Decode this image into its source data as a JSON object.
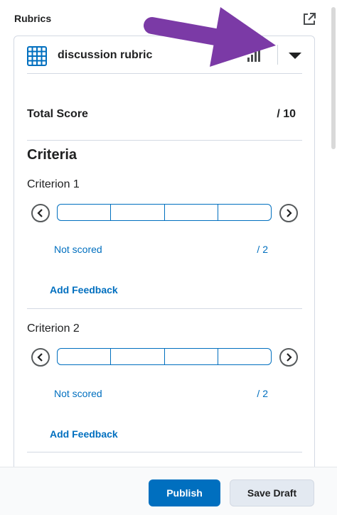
{
  "header": {
    "title": "Rubrics",
    "popout_icon": "external-link-icon"
  },
  "rubric": {
    "name": "discussion rubric",
    "icon": "grid-icon",
    "signal_icon": "signal-bars-icon",
    "expand_icon": "caret-down-icon"
  },
  "total": {
    "label": "Total Score",
    "value": "/ 10"
  },
  "criteria": {
    "heading": "Criteria",
    "items": [
      {
        "name": "Criterion 1",
        "status": "Not scored",
        "score": "/ 2",
        "feedback": "Add Feedback"
      },
      {
        "name": "Criterion 2",
        "status": "Not scored",
        "score": "/ 2",
        "feedback": "Add Feedback"
      }
    ]
  },
  "footer": {
    "publish": "Publish",
    "save_draft": "Save Draft"
  },
  "colors": {
    "accent": "#006fbf",
    "annotation": "#7b3aa6"
  }
}
